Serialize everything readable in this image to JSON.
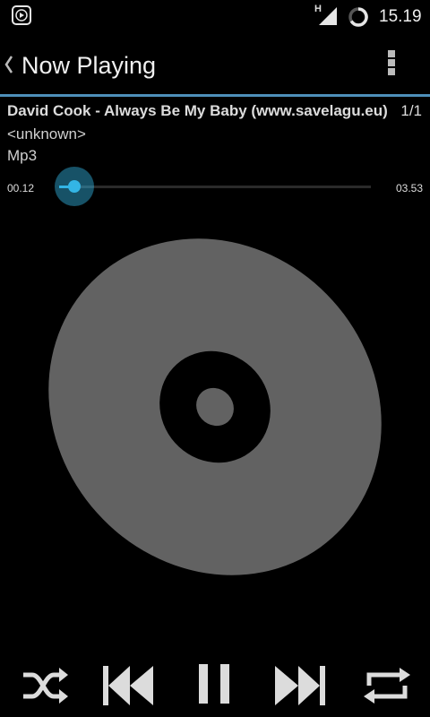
{
  "status_bar": {
    "network_type": "H",
    "time": "15.19"
  },
  "header": {
    "title": "Now Playing"
  },
  "track": {
    "title": "David Cook - Always Be My Baby (www.savelagu.eu)",
    "position": "1/1",
    "artist": "<unknown>",
    "format": "Mp3"
  },
  "playback": {
    "elapsed": "00.12",
    "duration": "03.53",
    "progress_fraction": 0.05
  },
  "controls": {
    "shuffle": "shuffle-icon",
    "previous": "previous-icon",
    "play_pause": "pause-icon",
    "next": "next-icon",
    "repeat": "repeat-icon"
  },
  "colors": {
    "accent": "#33b5e5",
    "divider": "#4e8fb9",
    "disc": "#626262"
  }
}
